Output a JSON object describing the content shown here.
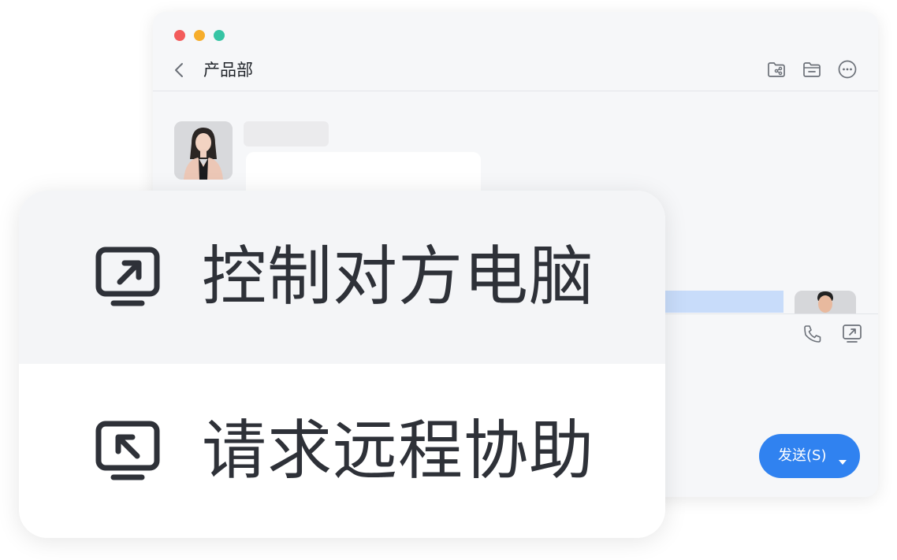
{
  "chat": {
    "title": "产品部",
    "header_icons": [
      "shared-folder-icon",
      "folder-icon",
      "more-icon"
    ],
    "toolbar_icons": [
      "phone-icon",
      "remote-screen-icon"
    ],
    "send_button": {
      "label": "发送(S)",
      "dropdown_icon": "caret-down-icon"
    }
  },
  "menu": {
    "items": [
      {
        "label": "控制对方电脑",
        "icon": "remote-control-out-icon"
      },
      {
        "label": "请求远程协助",
        "icon": "remote-assist-in-icon"
      }
    ]
  },
  "colors": {
    "accent": "#3082f0",
    "window_bg": "#f6f7f9",
    "text_dark": "#2e3138",
    "highlight_bubble": "#c8dcfa",
    "traffic_red": "#f35b5b",
    "traffic_yellow": "#f6ad2b",
    "traffic_green": "#36c4a4"
  }
}
